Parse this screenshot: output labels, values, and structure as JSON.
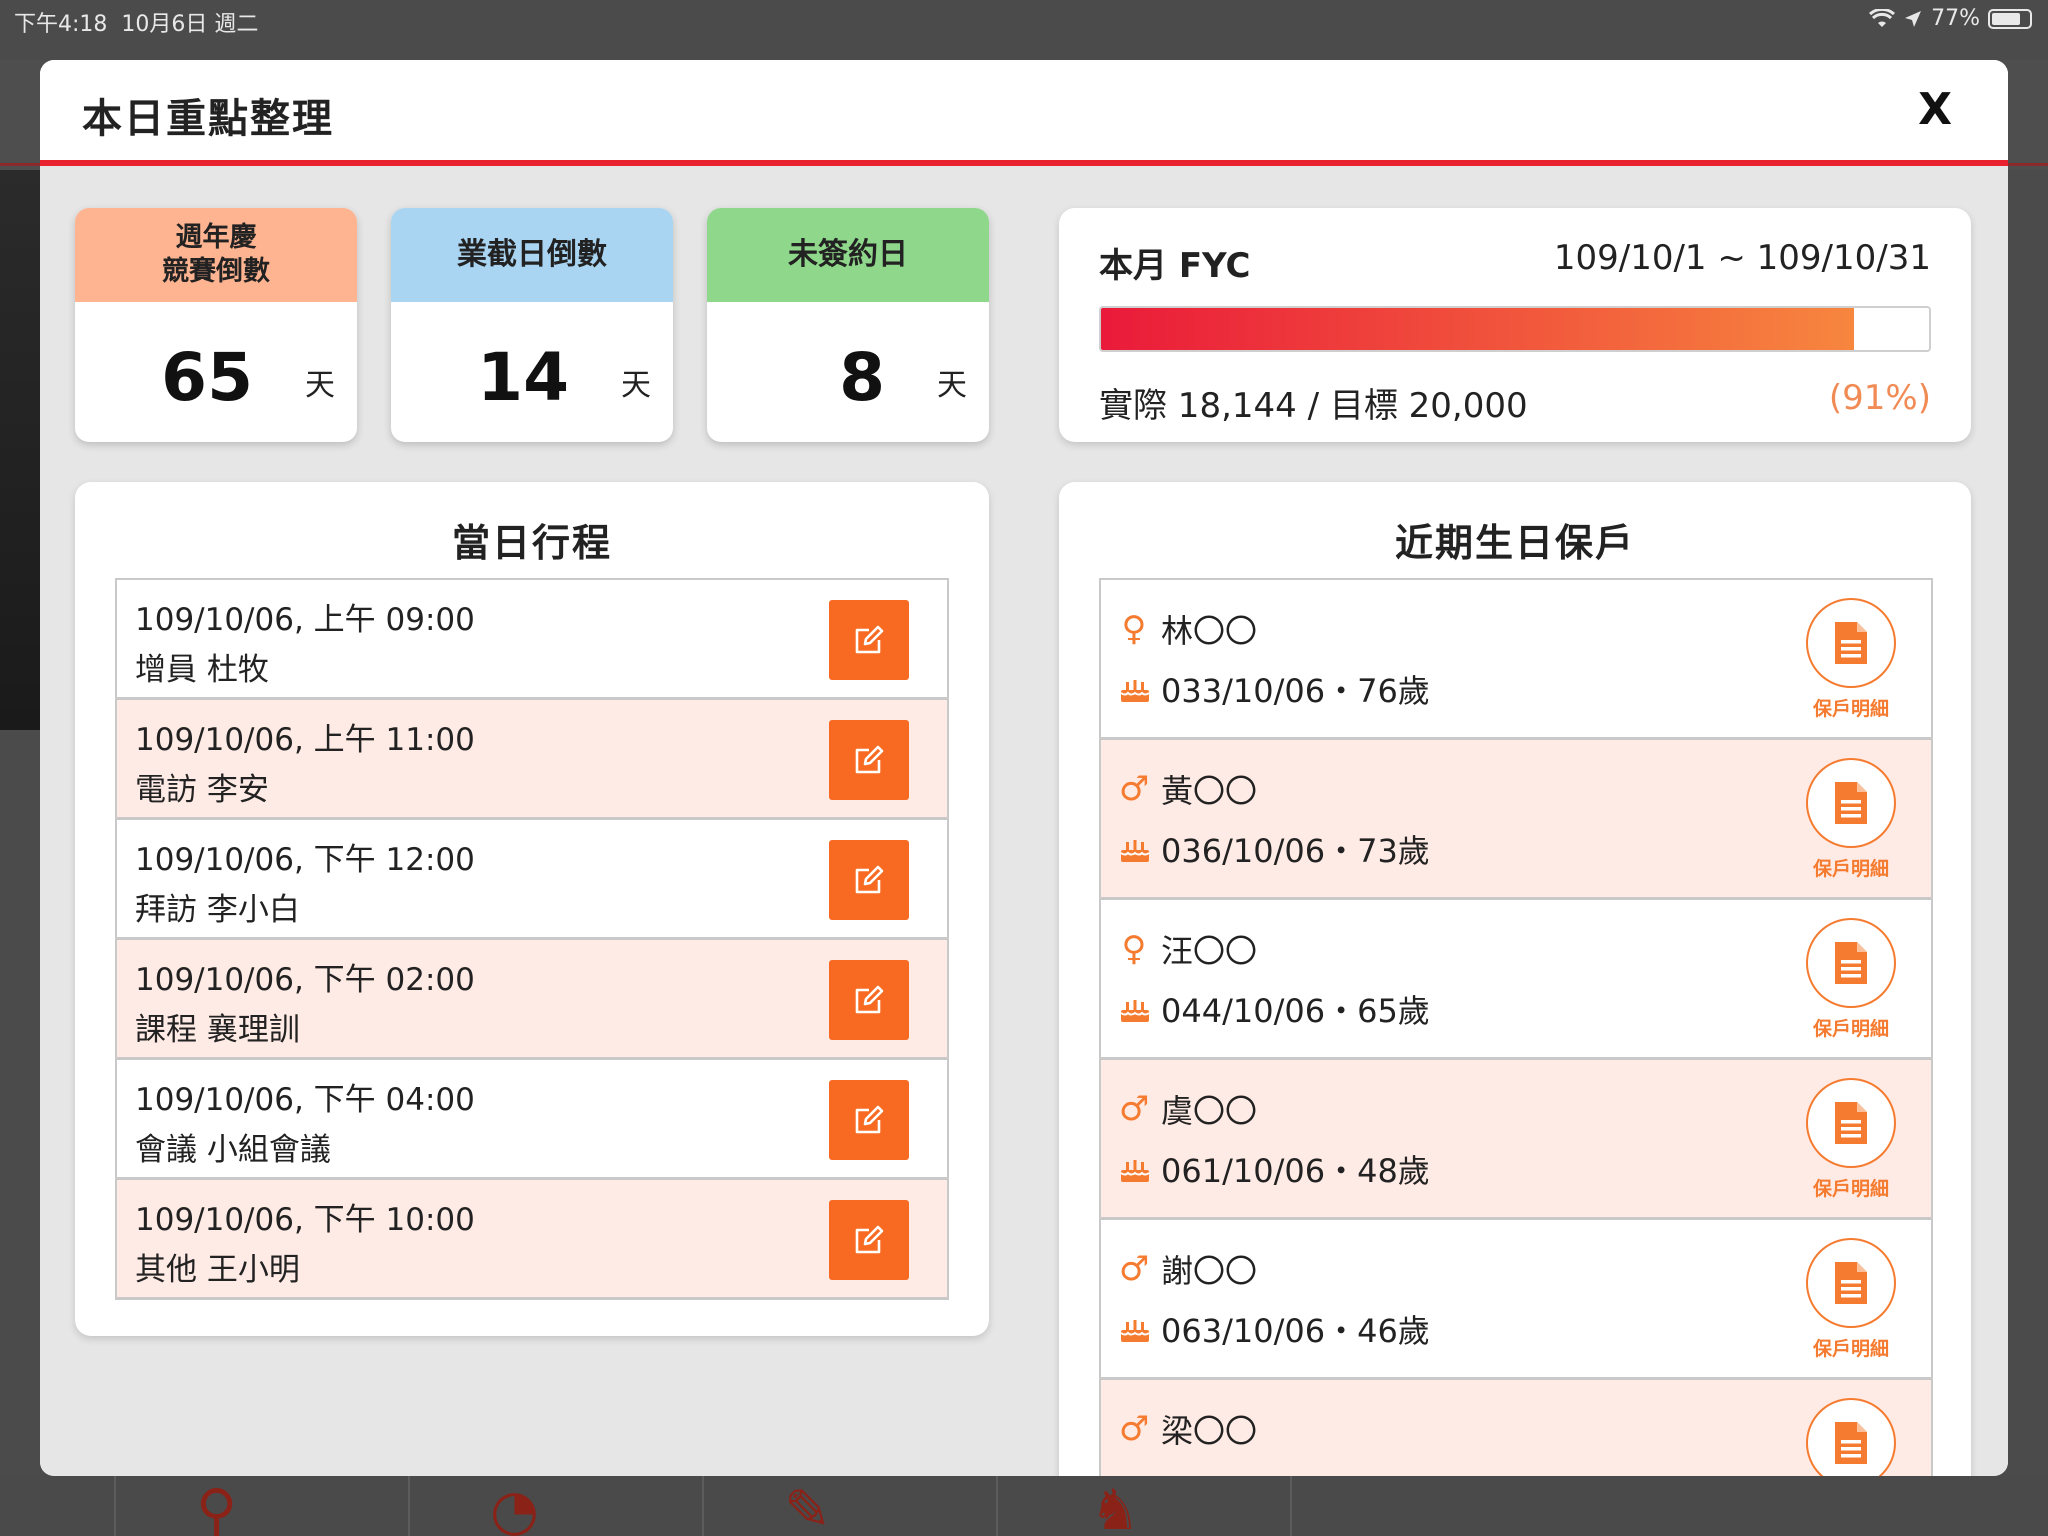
{
  "status_bar": {
    "time": "下午4:18",
    "date": "10月6日 週二",
    "battery": "77%"
  },
  "modal": {
    "title": "本日重點整理",
    "close_label": "X"
  },
  "countdowns": [
    {
      "label": "週年慶\n競賽倒數",
      "value": "65",
      "unit": "天",
      "color": "#ffb491"
    },
    {
      "label": "業截日倒數",
      "value": "14",
      "unit": "天",
      "color": "#a9d4f2"
    },
    {
      "label": "未簽約日",
      "value": "8",
      "unit": "天",
      "color": "#8fd78a"
    }
  ],
  "fyc": {
    "title": "本月 FYC",
    "range": "109/10/1 ~ 109/10/31",
    "actual_text": "實際 18,144 / 目標 20,000",
    "percent_text": "(91%)",
    "progress": 0.91
  },
  "schedule": {
    "title": "當日行程",
    "items": [
      {
        "time": "109/10/06, 上午 09:00",
        "desc": "增員 杜牧"
      },
      {
        "time": "109/10/06, 上午 11:00",
        "desc": "電訪 李安"
      },
      {
        "time": "109/10/06, 下午 12:00",
        "desc": "拜訪 李小白"
      },
      {
        "time": "109/10/06, 下午 02:00",
        "desc": "課程 襄理訓"
      },
      {
        "time": "109/10/06, 下午 04:00",
        "desc": "會議 小組會議"
      },
      {
        "time": "109/10/06, 下午 10:00",
        "desc": "其他 王小明"
      }
    ]
  },
  "birthdays": {
    "title": "近期生日保戶",
    "detail_label": "保戶明細",
    "items": [
      {
        "gender": "female",
        "gender_icon": "♀",
        "name": "林〇〇",
        "date": "033/10/06・76歲"
      },
      {
        "gender": "male",
        "gender_icon": "♂",
        "name": "黃〇〇",
        "date": "036/10/06・73歲"
      },
      {
        "gender": "female",
        "gender_icon": "♀",
        "name": "汪〇〇",
        "date": "044/10/06・65歲"
      },
      {
        "gender": "male",
        "gender_icon": "♂",
        "name": "虞〇〇",
        "date": "061/10/06・48歲"
      },
      {
        "gender": "male",
        "gender_icon": "♂",
        "name": "謝〇〇",
        "date": "063/10/06・46歲"
      },
      {
        "gender": "male",
        "gender_icon": "♂",
        "name": "梁〇〇",
        "date": ""
      }
    ]
  },
  "colors": {
    "accent_red": "#e8222e",
    "edit_orange": "#f86a22",
    "detail_orange": "#f57b30",
    "alt_row": "#ffebe5"
  }
}
